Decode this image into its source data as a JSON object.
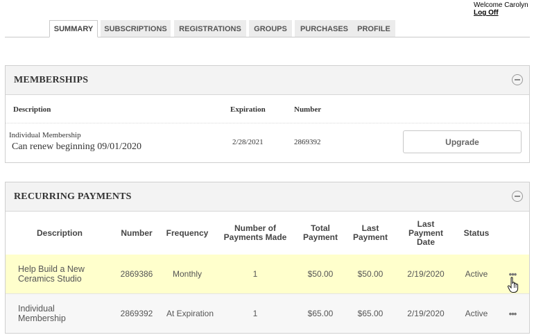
{
  "header": {
    "welcome": "Welcome Carolyn",
    "logoff": "Log Off"
  },
  "tabs": [
    "SUMMARY",
    "SUBSCRIPTIONS",
    "REGISTRATIONS",
    "GROUPS",
    "PURCHASES",
    "PROFILE"
  ],
  "memberships": {
    "title": "MEMBERSHIPS",
    "columns": {
      "description": "Description",
      "expiration": "Expiration",
      "number": "Number"
    },
    "row": {
      "type": "Individual Membership",
      "note": "Can renew beginning 09/01/2020",
      "expiration": "2/28/2021",
      "number": "2869392",
      "action": "Upgrade"
    }
  },
  "recurring": {
    "title": "RECURRING PAYMENTS",
    "columns": [
      "Description",
      "Number",
      "Frequency",
      "Number of Payments Made",
      "Total Payment",
      "Last Payment",
      "Last Payment Date",
      "Status"
    ],
    "rows": [
      {
        "description": "Help Build a New Ceramics Studio",
        "number": "2869386",
        "frequency": "Monthly",
        "payments": "1",
        "total": "$50.00",
        "last": "$50.00",
        "date": "2/19/2020",
        "status": "Active",
        "more": "•••"
      },
      {
        "description": "Individual Membership",
        "number": "2869392",
        "frequency": "At Expiration",
        "payments": "1",
        "total": "$65.00",
        "last": "$65.00",
        "date": "2/19/2020",
        "status": "Active",
        "more": "•••"
      }
    ]
  },
  "colors": {
    "highlight_row": "#ffffcc",
    "alt_row": "#f7f7f7",
    "panel_header": "#f3f3f3"
  },
  "icons": [
    "collapse-icon",
    "more-icon",
    "hand-pointer-icon"
  ]
}
